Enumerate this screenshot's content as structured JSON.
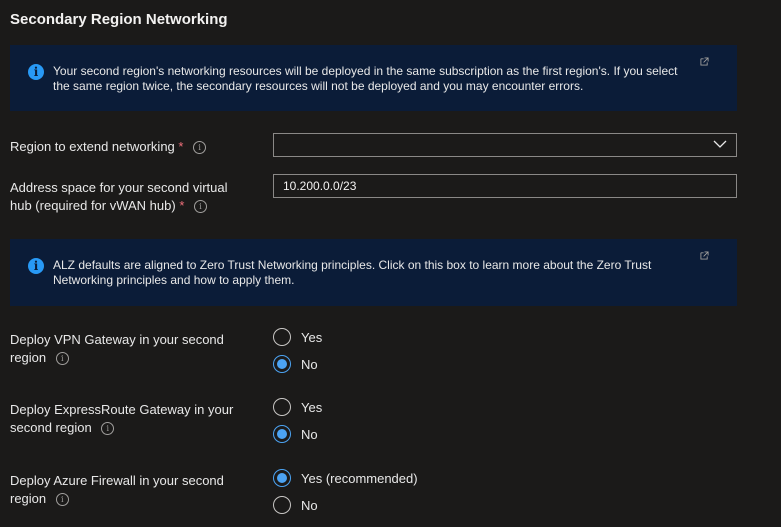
{
  "section_title": "Secondary Region Networking",
  "info1": {
    "line1": "Your second region's networking resources will be deployed in the same subscription as the first region's.  If you select",
    "line2": "the same region twice, the secondary resources will not be deployed and you may encounter errors."
  },
  "region_field": {
    "label": "Region to extend networking",
    "required_mark": "*",
    "value": ""
  },
  "address_field": {
    "label_line1": "Address space for your second virtual",
    "label_line2": "hub (required for vWAN hub)",
    "required_mark": "*",
    "value": "10.200.0.0/23"
  },
  "info2": {
    "line1": "ALZ defaults are aligned to Zero Trust Networking principles. Click on this box to learn more about the Zero Trust",
    "line2": "Networking principles and how to apply them."
  },
  "vpn": {
    "label_line1": "Deploy VPN Gateway in your second",
    "label_line2": "region",
    "options": [
      {
        "label": "Yes",
        "selected": false
      },
      {
        "label": "No",
        "selected": true
      }
    ]
  },
  "expressroute": {
    "label_line1": "Deploy ExpressRoute Gateway in your",
    "label_line2": "second region",
    "options": [
      {
        "label": "Yes",
        "selected": false
      },
      {
        "label": "No",
        "selected": true
      }
    ]
  },
  "firewall": {
    "label_line1": "Deploy Azure Firewall in your second",
    "label_line2": "region",
    "options": [
      {
        "label": "Yes (recommended)",
        "selected": true
      },
      {
        "label": "No",
        "selected": false
      }
    ]
  },
  "tooltip_glyph": "i",
  "info_glyph": "i"
}
